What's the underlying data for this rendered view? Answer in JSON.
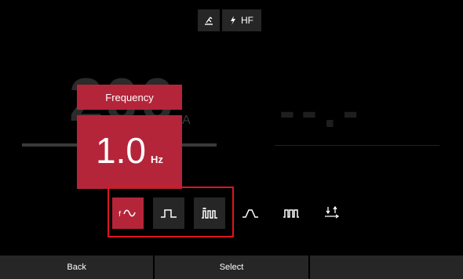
{
  "topbar": {
    "torch_icon": "torch-icon",
    "hf_icon": "lightning-icon",
    "hf_label": "HF"
  },
  "background": {
    "amperage": "200",
    "amperage_unit": "A",
    "secondary_value": "--.-"
  },
  "popup": {
    "title": "Frequency",
    "value": "1.0",
    "unit": "Hz"
  },
  "mode_icons": [
    {
      "name": "ac-frequency-icon",
      "selected": true
    },
    {
      "name": "pulse-square-icon",
      "selected": false
    },
    {
      "name": "pulse-dc-icon",
      "selected": false
    },
    {
      "name": "ramp-pulse-icon",
      "selected": false
    },
    {
      "name": "multi-pulse-icon",
      "selected": false
    },
    {
      "name": "two-four-stroke-icon",
      "selected": false
    }
  ],
  "softkeys": {
    "back": "Back",
    "select": "Select",
    "third": ""
  },
  "colors": {
    "accent": "#b5253a",
    "panel": "#262626",
    "highlight": "#e0141e"
  }
}
